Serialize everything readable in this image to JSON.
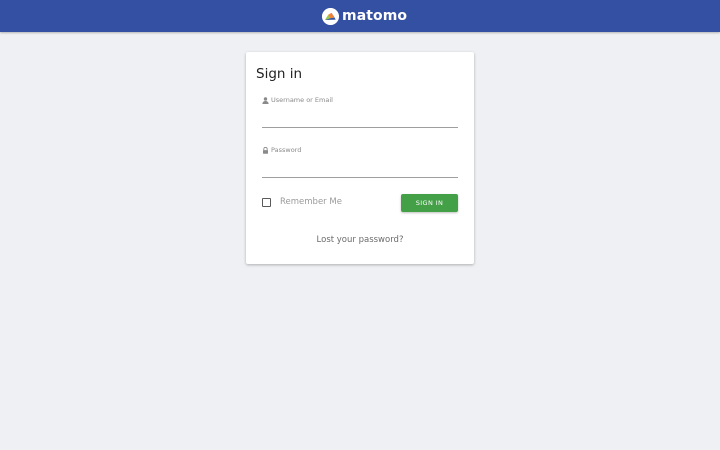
{
  "header": {
    "brand_name": "matomo",
    "logo_icon": "matomo-logo-icon",
    "background_color": "#3450a3"
  },
  "login_card": {
    "title": "Sign in",
    "username": {
      "label": "Username or Email",
      "icon": "user-icon",
      "value": ""
    },
    "password": {
      "label": "Password",
      "icon": "lock-icon",
      "value": ""
    },
    "remember_me": {
      "label": "Remember Me",
      "checked": false
    },
    "sign_in_button": {
      "label": "SIGN IN",
      "color": "#43a047"
    },
    "lost_password_link": "Lost your password?"
  },
  "page_background": "#eef0f3"
}
